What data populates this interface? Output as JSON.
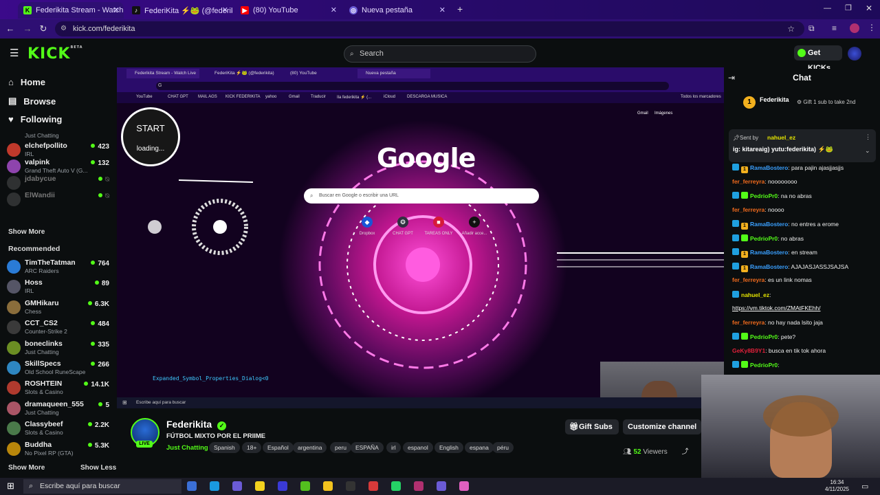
{
  "browser": {
    "tabs": [
      {
        "label": "Federikita Stream - Watch Live"
      },
      {
        "label": "FederiKita ⚡🐸 (@federikita..."
      },
      {
        "label": "(80) YouTube"
      },
      {
        "label": "Nueva pestaña"
      }
    ],
    "url": "kick.com/federikita"
  },
  "kick": {
    "logo": "KICK",
    "logo_beta": "BETA",
    "search_placeholder": "Search",
    "get_kicks": "Get KICKs"
  },
  "sidebar": {
    "nav": [
      {
        "label": "Home"
      },
      {
        "label": "Browse"
      },
      {
        "label": "Following"
      }
    ],
    "following_partial_cat": "Just Chatting",
    "following": [
      {
        "name": "elchefpollito",
        "category": "IRL",
        "viewers": "423"
      },
      {
        "name": "valpink",
        "category": "Grand Theft Auto V (G...",
        "viewers": "132"
      },
      {
        "name": "jdabycue",
        "category": "",
        "viewers": ""
      },
      {
        "name": "ElWandii",
        "category": "",
        "viewers": ""
      }
    ],
    "show_more": "Show More",
    "recommended_label": "Recommended",
    "recommended": [
      {
        "name": "TimTheTatman",
        "category": "ARC Raiders",
        "viewers": "764"
      },
      {
        "name": "Hoss",
        "category": "IRL",
        "viewers": "89"
      },
      {
        "name": "GMHikaru",
        "category": "Chess",
        "viewers": "6.3K"
      },
      {
        "name": "CCT_CS2",
        "category": "Counter-Strike 2",
        "viewers": "484"
      },
      {
        "name": "boneclinks",
        "category": "Just Chatting",
        "viewers": "335"
      },
      {
        "name": "SkillSpecs",
        "category": "Old School RuneScape",
        "viewers": "266"
      },
      {
        "name": "ROSHTEIN",
        "category": "Slots & Casino",
        "viewers": "14.1K"
      },
      {
        "name": "dramaqueen_555",
        "category": "Just Chatting",
        "viewers": "5"
      },
      {
        "name": "Classybeef",
        "category": "Slots & Casino",
        "viewers": "2.2K"
      },
      {
        "name": "Buddha",
        "category": "No Pixel RP (GTA)",
        "viewers": "5.3K"
      }
    ],
    "show_more_2": "Show More",
    "show_less": "Show Less"
  },
  "stream_screen": {
    "inner_tabs": [
      {
        "label": "Federikita Stream - Watch Live"
      },
      {
        "label": "FederiKita ⚡🐸 (@federikita)"
      },
      {
        "label": "(80) YouTube"
      },
      {
        "label": "Nueva pestaña"
      }
    ],
    "inner_url": "G",
    "bookmarks": [
      "YouTube",
      "CHAT GPT",
      "MAIL AGS",
      "KICK FEDERIKITA",
      "yahoo",
      "Gmail",
      "Traducir",
      "Ila federikita ⚡ (...",
      "iCloud",
      "DESCARGA MUSICA"
    ],
    "all_bookmarks": "Todos los marcadores",
    "gmail": "Gmail",
    "images": "Imágenes",
    "google_logo": "Google",
    "google_search_placeholder": "Buscar en Google o escribir una URL",
    "shortcuts": [
      {
        "label": "Dropbox"
      },
      {
        "label": "CHAT GPT"
      },
      {
        "label": "TAREAS ONLY"
      },
      {
        "label": "Añadir acce..."
      }
    ],
    "start_label": "START",
    "loading_label": "loading...",
    "dialog_text": "Expanded_Symbol_Properties_Dialog<0",
    "inner_taskbar_search": "Escribe aquí para buscar"
  },
  "channel": {
    "name": "Federikita",
    "live_badge": "LIVE",
    "title": "FÚTBOL MIXTO POR EL PRIIME",
    "category": "Just Chatting",
    "tags": [
      "Spanish",
      "18+",
      "Español",
      "argentina",
      "peru",
      "ESPAÑA",
      "irl",
      "espanol",
      "English",
      "espana",
      "péru"
    ],
    "gift_subs": "Gift Subs",
    "customize": "Customize channel",
    "viewers_count": "52",
    "viewers_label": "Viewers"
  },
  "chat": {
    "title": "Chat",
    "top_gifter": "Federikita",
    "top_gifter_count": "1",
    "gift_promo": "Gift 1 sub to take 2nd",
    "pinned_sent_by": "Sent by",
    "pinned_user": "nahuel_ez",
    "pinned_text": "ig: kitareaig) yutu:federikita) ⚡🐸",
    "messages": [
      {
        "user": "RamaBostero",
        "text": ": para pajin ajasjjasjjs",
        "color": "#3aa0ff",
        "badges": [
          "blue",
          "gold"
        ]
      },
      {
        "user": "fer_ferreyra",
        "text": ": noooooooo",
        "color": "#f26b1d",
        "badges": []
      },
      {
        "user": "PedrioPr0",
        "text": ": na no abras",
        "color": "#53fc18",
        "badges": [
          "blue",
          "green"
        ]
      },
      {
        "user": "fer_ferreyra",
        "text": ": noooo",
        "color": "#f26b1d",
        "badges": []
      },
      {
        "user": "RamaBostero",
        "text": ": no entres a erome",
        "color": "#3aa0ff",
        "badges": [
          "blue",
          "gold"
        ]
      },
      {
        "user": "PedrioPr0",
        "text": ": no abras",
        "color": "#53fc18",
        "badges": [
          "blue",
          "green"
        ]
      },
      {
        "user": "RamaBostero",
        "text": ": en stream",
        "color": "#3aa0ff",
        "badges": [
          "blue",
          "gold"
        ]
      },
      {
        "user": "RamaBostero",
        "text": ": AJAJASJASSJSAJSA",
        "color": "#3aa0ff",
        "badges": [
          "blue",
          "gold"
        ]
      },
      {
        "user": "fer_ferreyra",
        "text": ": es un link nomas",
        "color": "#f26b1d",
        "badges": []
      },
      {
        "user": "nahuel_ez",
        "text": ":",
        "color": "#e6e600",
        "badges": [
          "blue"
        ]
      },
      {
        "user": "",
        "text": "https://vm.tiktok.com/ZMAtFKEhh/",
        "color": "#ffffff",
        "badges": []
      },
      {
        "user": "fer_ferreyra",
        "text": ": no hay nada lsito jaja",
        "color": "#f26b1d",
        "badges": []
      },
      {
        "user": "PedrioPr0",
        "text": ": pete?",
        "color": "#53fc18",
        "badges": [
          "blue",
          "green"
        ]
      },
      {
        "user": "GeKy8B9Y1",
        "text": ": busca en tik tok ahora",
        "color": "#e0203a",
        "badges": []
      },
      {
        "user": "PedrioPr0",
        "text": ":",
        "color": "#53fc18",
        "badges": [
          "blue",
          "green"
        ]
      }
    ]
  },
  "windows": {
    "search": "Escribe aquí para buscar",
    "time": "16:34",
    "date": "4/11/2025"
  }
}
